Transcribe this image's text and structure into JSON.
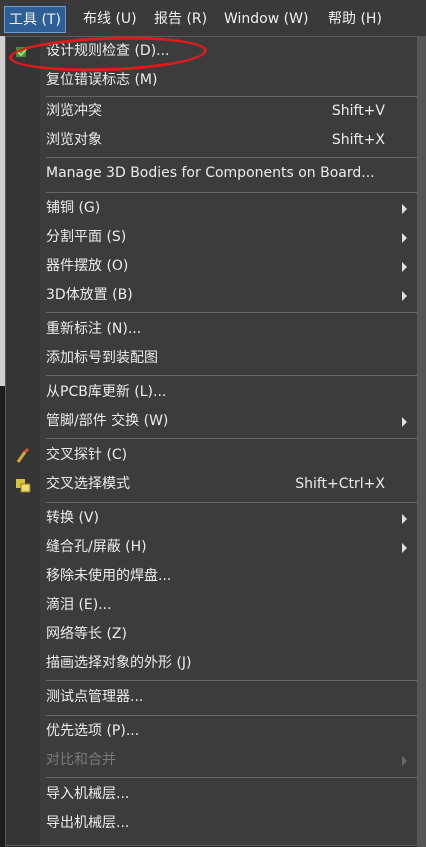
{
  "menubar": {
    "items": [
      {
        "label": "工具 (T)",
        "active": true
      },
      {
        "label": "布线 (U)"
      },
      {
        "label": "报告 (R)"
      },
      {
        "label": "Window (W)"
      },
      {
        "label": "帮助 (H)"
      }
    ]
  },
  "menu": {
    "items": [
      {
        "label": "设计规则检查 (D)...",
        "icon": "drc-check-icon"
      },
      {
        "label": "复位错误标志 (M)"
      },
      {
        "label": "浏览冲突",
        "shortcut": "Shift+V"
      },
      {
        "label": "浏览对象",
        "shortcut": "Shift+X"
      },
      {
        "label": "Manage 3D Bodies for Components on Board..."
      },
      {
        "label": "铺铜 (G)",
        "submenu": true
      },
      {
        "label": "分割平面 (S)",
        "submenu": true
      },
      {
        "label": "器件摆放 (O)",
        "submenu": true
      },
      {
        "label": "3D体放置 (B)",
        "submenu": true
      },
      {
        "label": "重新标注 (N)..."
      },
      {
        "label": "添加标号到装配图"
      },
      {
        "label": "从PCB库更新 (L)..."
      },
      {
        "label": "管脚/部件 交换 (W)",
        "submenu": true
      },
      {
        "label": "交叉探针 (C)",
        "icon": "cross-probe-icon"
      },
      {
        "label": "交叉选择模式",
        "shortcut": "Shift+Ctrl+X",
        "icon": "cross-select-icon"
      },
      {
        "label": "转换 (V)",
        "submenu": true
      },
      {
        "label": "缝合孔/屏蔽 (H)",
        "submenu": true
      },
      {
        "label": "移除未使用的焊盘..."
      },
      {
        "label": "滴泪 (E)..."
      },
      {
        "label": "网络等长 (Z)"
      },
      {
        "label": "描画选择对象的外形 (J)"
      },
      {
        "label": "测试点管理器..."
      },
      {
        "label": "优先选项 (P)..."
      },
      {
        "label": "对比和合并",
        "submenu": true,
        "disabled": true
      },
      {
        "label": "导入机械层..."
      },
      {
        "label": "导出机械层..."
      }
    ]
  },
  "colors": {
    "menu_bg": "#3c3c3c",
    "active_menubar": "#2d5f96",
    "annotation_circle": "#e11a1a"
  }
}
